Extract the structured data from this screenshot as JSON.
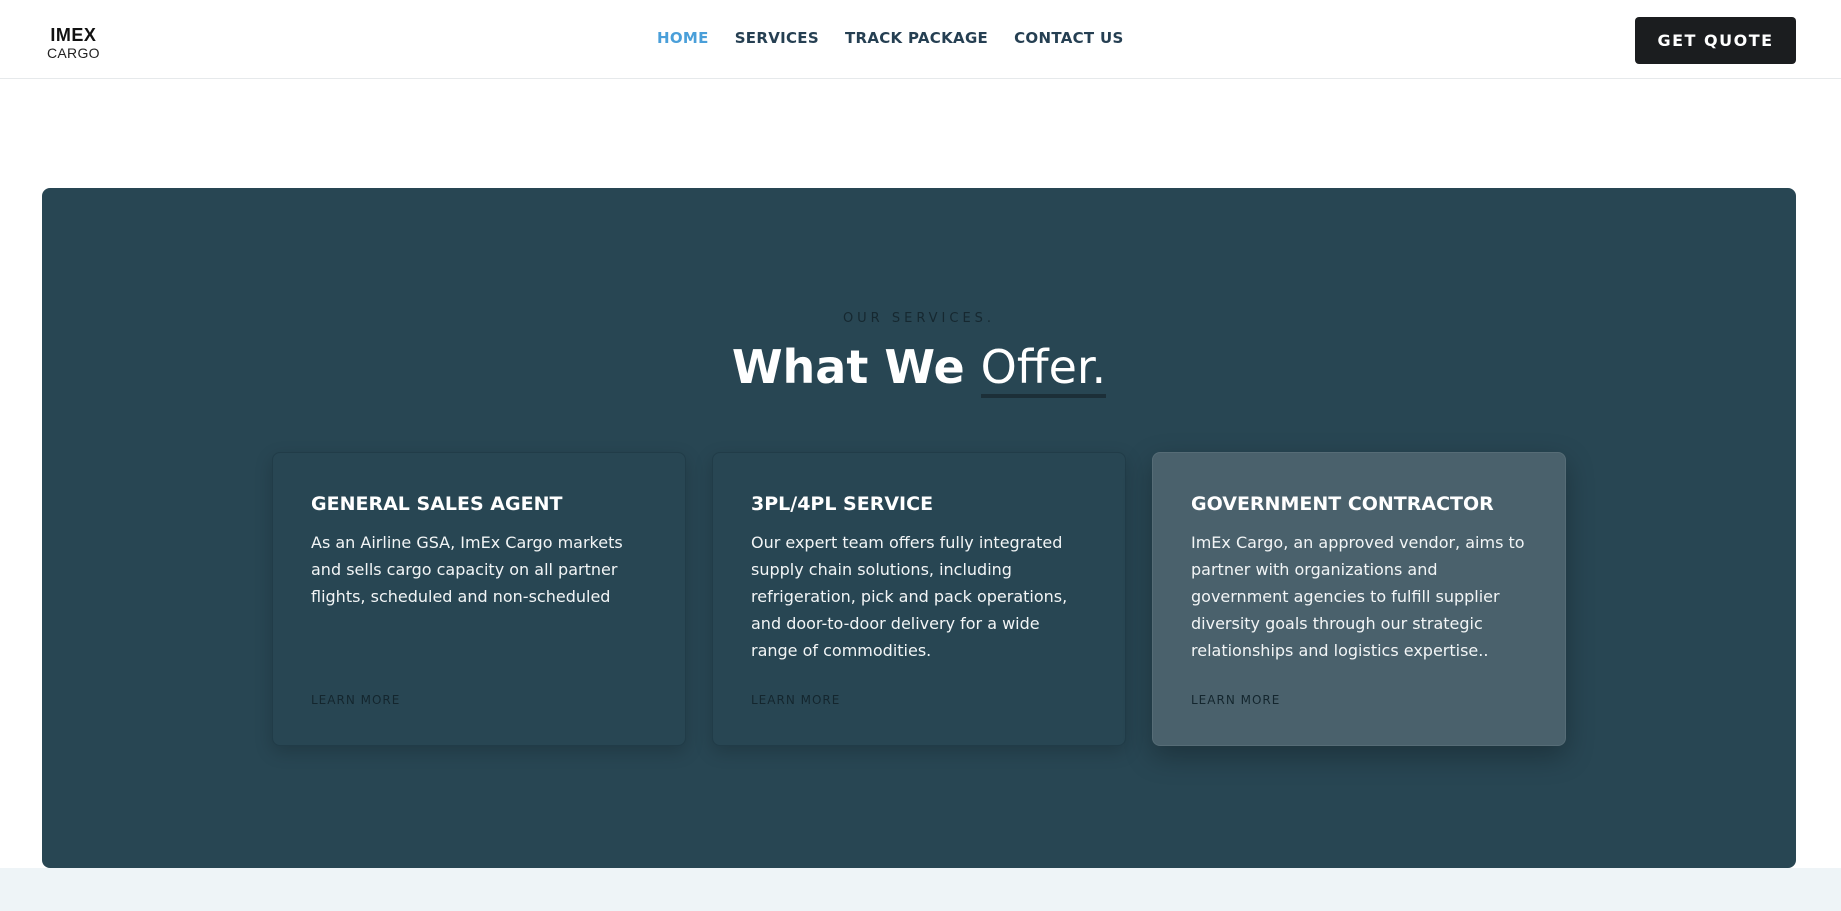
{
  "header": {
    "logo_top": "IMEX",
    "logo_bottom": "CARGO",
    "nav": [
      {
        "label": "HOME",
        "active": true
      },
      {
        "label": "SERVICES",
        "active": false
      },
      {
        "label": "TRACK PACKAGE",
        "active": false
      },
      {
        "label": "CONTACT US",
        "active": false
      }
    ],
    "cta_label": "GET QUOTE"
  },
  "services": {
    "eyebrow": "OUR SERVICES.",
    "heading_strong": "What We",
    "heading_light": "Offer.",
    "cards": [
      {
        "title": "GENERAL SALES AGENT",
        "text": "As an Airline GSA, ImEx Cargo markets and sells cargo capacity on all partner flights, scheduled and non-scheduled",
        "link": "LEARN MORE"
      },
      {
        "title": "3PL/4PL SERVICE",
        "text": "Our expert team offers fully integrated supply chain solutions, including refrigeration, pick and pack operations, and door-to-door delivery for a wide range of commodities.",
        "link": "LEARN MORE"
      },
      {
        "title": "GOVERNMENT CONTRACTOR",
        "text": "ImEx Cargo, an approved vendor, aims to partner with organizations and government agencies to fulfill supplier diversity goals through our strategic relationships and logistics expertise..",
        "link": "LEARN MORE"
      }
    ]
  },
  "colors": {
    "panel": "#284653",
    "nav_text": "#253f52",
    "nav_active": "#4a9fd9",
    "cta_bg": "#1b1d1f",
    "card_highlight": "#4a616c"
  }
}
